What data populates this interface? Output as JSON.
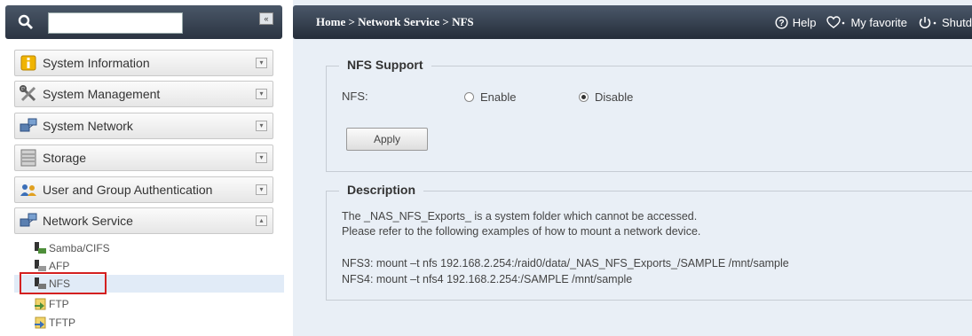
{
  "search": {
    "placeholder": "",
    "value": ""
  },
  "sidebar": {
    "collapse_label": "«",
    "menu": [
      {
        "label": "System Information",
        "icon": "info-icon"
      },
      {
        "label": "System Management",
        "icon": "tools-icon"
      },
      {
        "label": "System Network",
        "icon": "network-icon"
      },
      {
        "label": "Storage",
        "icon": "storage-icon"
      },
      {
        "label": "User and Group Authentication",
        "icon": "users-icon"
      },
      {
        "label": "Network Service",
        "icon": "network-service-icon"
      }
    ],
    "submenu": [
      {
        "label": "Samba/CIFS",
        "icon": "samba-icon"
      },
      {
        "label": "AFP",
        "icon": "afp-icon"
      },
      {
        "label": "NFS",
        "icon": "nfs-icon",
        "selected": true
      },
      {
        "label": "FTP",
        "icon": "ftp-icon"
      },
      {
        "label": "TFTP",
        "icon": "tftp-icon"
      }
    ]
  },
  "header": {
    "breadcrumb": "Home > Network Service > NFS",
    "help": "Help",
    "favorite": "My favorite",
    "shutdown": "Shutd"
  },
  "nfs_support": {
    "title": "NFS Support",
    "field_label": "NFS:",
    "options": [
      "Enable",
      "Disable"
    ],
    "selected": "Disable",
    "apply_label": "Apply"
  },
  "description": {
    "title": "Description",
    "line1": "The _NAS_NFS_Exports_ is a system folder which cannot be accessed.",
    "line2": "Please refer to the following examples of how to mount a network device.",
    "nfs3": "NFS3: mount –t nfs 192.168.2.254:/raid0/data/_NAS_NFS_Exports_/SAMPLE   /mnt/sample",
    "nfs4": "NFS4: mount –t nfs4 192.168.2.254:/SAMPLE   /mnt/sample"
  },
  "colors": {
    "topbar": "#2b3442",
    "panel_bg": "#e9eff6",
    "highlight": "#d42020"
  }
}
